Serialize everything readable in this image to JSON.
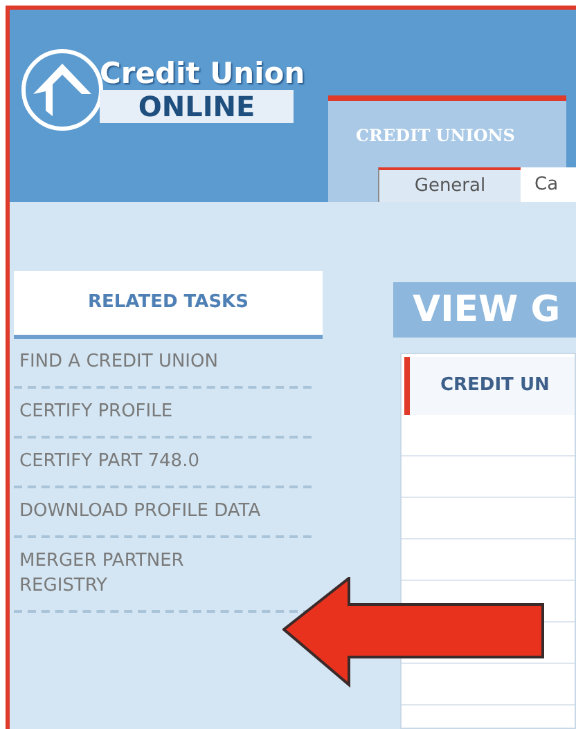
{
  "logo": {
    "line_1": "Credit Union",
    "line_2": "ONLINE"
  },
  "tabs": [
    {
      "label": "CREDIT UNIONS",
      "selected": true
    }
  ],
  "subtabs": [
    {
      "label": "General",
      "selected": true
    },
    {
      "label": "Ca",
      "selected": false
    }
  ],
  "sidebar": {
    "title": "RELATED TASKS",
    "items": [
      "FIND A CREDIT UNION",
      "CERTIFY PROFILE",
      "CERTIFY PART 748.0",
      "DOWNLOAD PROFILE DATA",
      "MERGER PARTNER REGISTRY"
    ]
  },
  "main": {
    "title": "VIEW G",
    "table": {
      "columns": [
        "CREDIT UN"
      ]
    }
  }
}
